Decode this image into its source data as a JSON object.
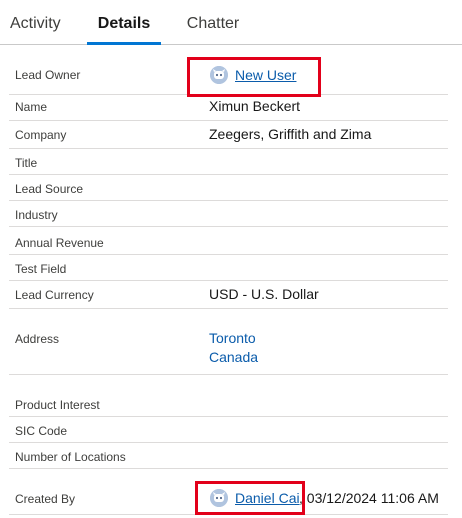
{
  "tabs": {
    "activity": "Activity",
    "details": "Details",
    "chatter": "Chatter"
  },
  "fields": {
    "lead_owner": {
      "label": "Lead Owner",
      "value": "New User"
    },
    "name": {
      "label": "Name",
      "value": "Ximun Beckert"
    },
    "company": {
      "label": "Company",
      "value": "Zeegers, Griffith and Zima"
    },
    "title": {
      "label": "Title",
      "value": ""
    },
    "lead_source": {
      "label": "Lead Source",
      "value": ""
    },
    "industry": {
      "label": "Industry",
      "value": ""
    },
    "annual_revenue": {
      "label": "Annual Revenue",
      "value": ""
    },
    "test_field": {
      "label": "Test Field",
      "value": ""
    },
    "lead_currency": {
      "label": "Lead Currency",
      "value": "USD - U.S. Dollar"
    },
    "address": {
      "label": "Address",
      "line1": "Toronto",
      "line2": "Canada"
    },
    "product_interest": {
      "label": "Product Interest",
      "value": ""
    },
    "sic_code": {
      "label": "SIC Code",
      "value": ""
    },
    "number_of_locations": {
      "label": "Number of Locations",
      "value": ""
    },
    "created_by": {
      "label": "Created By",
      "user": "Daniel Cai",
      "date": ", 03/12/2024 11:06 AM"
    }
  },
  "icons": {
    "owner_avatar": "user-avatar-icon",
    "creator_avatar": "user-avatar-icon"
  },
  "colors": {
    "accent": "#0176d3",
    "link": "#0b5cab",
    "highlight": "#e2001a",
    "avatar": "#b0c4df"
  }
}
